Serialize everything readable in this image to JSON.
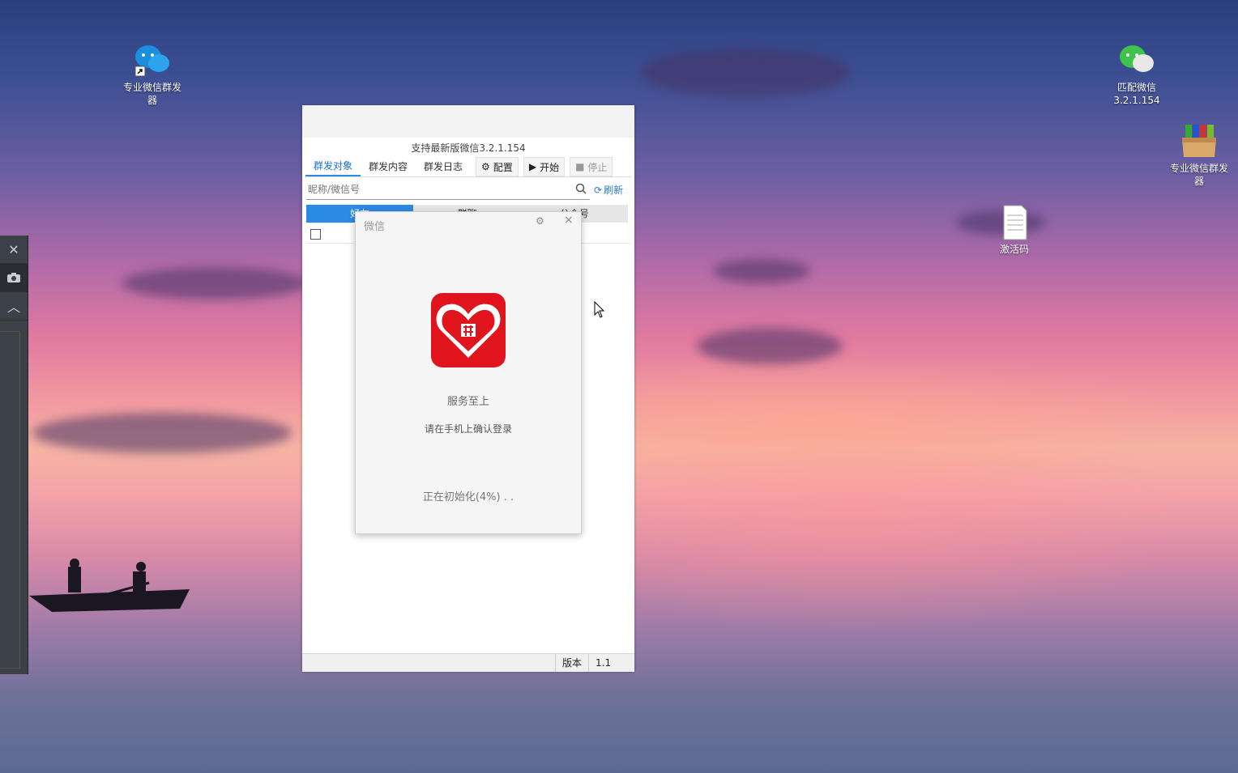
{
  "desktop": {
    "icons": [
      {
        "label_line1": "专业微信群发",
        "label_line2": "器"
      },
      {
        "label_line1": "匹配微信",
        "label_line2": "3.2.1.154"
      },
      {
        "label_line1": "专业微信群发",
        "label_line2": "器"
      },
      {
        "label_line1": "激活码",
        "label_line2": ""
      }
    ]
  },
  "side_toolbar": {
    "close": "✕",
    "camera": "camera-icon",
    "collapse": "︿"
  },
  "app": {
    "title": "支持最新版微信3.2.1.154",
    "tabs": [
      "群发对象",
      "群发内容",
      "群发日志"
    ],
    "buttons": {
      "config": "配置",
      "start": "开始",
      "stop": "停止"
    },
    "search_placeholder": "昵称/微信号",
    "refresh_label": "刷新",
    "subtabs": [
      "好友",
      "群聊",
      "公众号"
    ],
    "status": {
      "version_label": "版本",
      "version_value": "1.1"
    }
  },
  "wechat_login": {
    "title": "微信",
    "name": "服务至上",
    "hint": "请在手机上确认登录",
    "progress_text": "正在初始化(4%) . .",
    "progress_percent": 4,
    "accent": "#e0141d"
  }
}
